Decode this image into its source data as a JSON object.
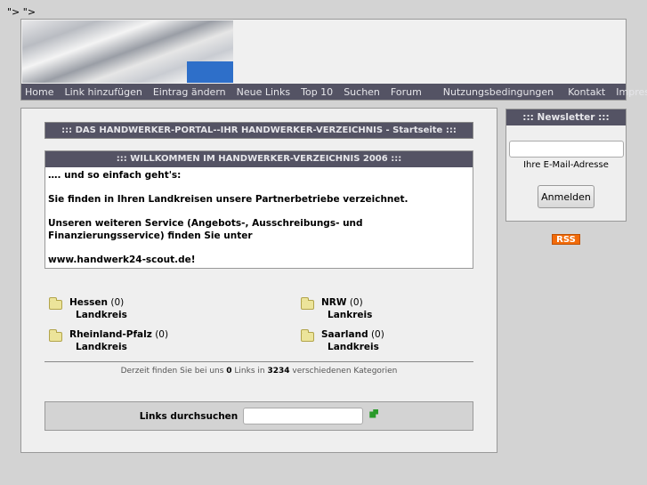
{
  "stray_text": "\"> \">",
  "nav": [
    "Home",
    "Link hinzufügen",
    "Eintrag ändern",
    "Neue Links",
    "Top 10",
    "Suchen",
    "Forum",
    "Nutzungsbedingungen",
    "Kontakt",
    "Impressum"
  ],
  "main": {
    "title": "::: DAS HANDWERKER-PORTAL--IHR HANDWERKER-VERZEICHNIS - Startseite :::",
    "welcome_title": "::: WILLKOMMEN IM HANDWERKER-VERZEICHNIS 2006 :::",
    "welcome_lines": [
      "…. und so einfach geht's:",
      "Sie finden in Ihren Landkreisen unsere Partnerbetriebe verzeichnet.",
      "Unseren weiteren Service (Angebots-, Ausschreibungs- und",
      "Finanzierungsservice) finden Sie unter",
      "www.handwerk24-scout.de!"
    ],
    "categories": [
      {
        "name": "Hessen",
        "count": "(0)",
        "sub": "Landkreis"
      },
      {
        "name": "NRW",
        "count": "(0)",
        "sub": "Lankreis"
      },
      {
        "name": "Rheinland-Pfalz",
        "count": "(0)",
        "sub": "Landkreis"
      },
      {
        "name": "Saarland",
        "count": "(0)",
        "sub": "Landkreis"
      }
    ],
    "stats": {
      "pre": "Derzeit finden Sie bei uns ",
      "links": "0",
      "mid": " Links in ",
      "cats": "3234",
      "post": " verschiedenen Kategorien"
    },
    "search_label": "Links durchsuchen",
    "search_value": ""
  },
  "sidebar": {
    "title": "::: Newsletter :::",
    "email_value": "",
    "email_hint": "Ihre E-Mail-Adresse",
    "submit": "Anmelden"
  },
  "rss": "RSS"
}
